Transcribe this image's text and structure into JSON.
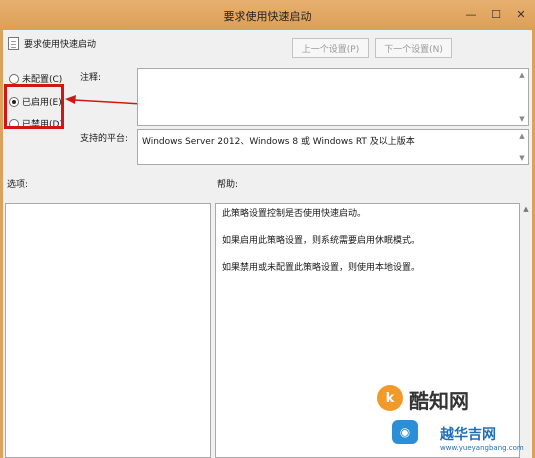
{
  "window": {
    "title": "要求使用快速启动",
    "minimize_glyph": "—",
    "maximize_glyph": "☐",
    "close_glyph": "✕"
  },
  "policy_name": "要求使用快速启动",
  "nav": {
    "prev": "上一个设置(P)",
    "next": "下一个设置(N)"
  },
  "options": {
    "not_configured": "未配置(C)",
    "enabled": "已启用(E)",
    "disabled": "已禁用(D)",
    "selected": "enabled"
  },
  "comment_label": "注释:",
  "platform": {
    "label": "支持的平台:",
    "value": "Windows Server 2012、Windows 8 或 Windows RT 及以上版本"
  },
  "options_label": "选项:",
  "help": {
    "label": "帮助:",
    "paragraphs": [
      "此策略设置控制是否使用快速启动。",
      "如果启用此策略设置，则系统需要启用休眠模式。",
      "如果禁用或未配置此策略设置，则使用本地设置。"
    ]
  },
  "watermark": {
    "brand1": "酷知网",
    "brand2": "越华吉网",
    "url": "www.yueyangbang.com"
  },
  "colors": {
    "titlebar": "#e0a55f",
    "highlight": "#d11616"
  }
}
